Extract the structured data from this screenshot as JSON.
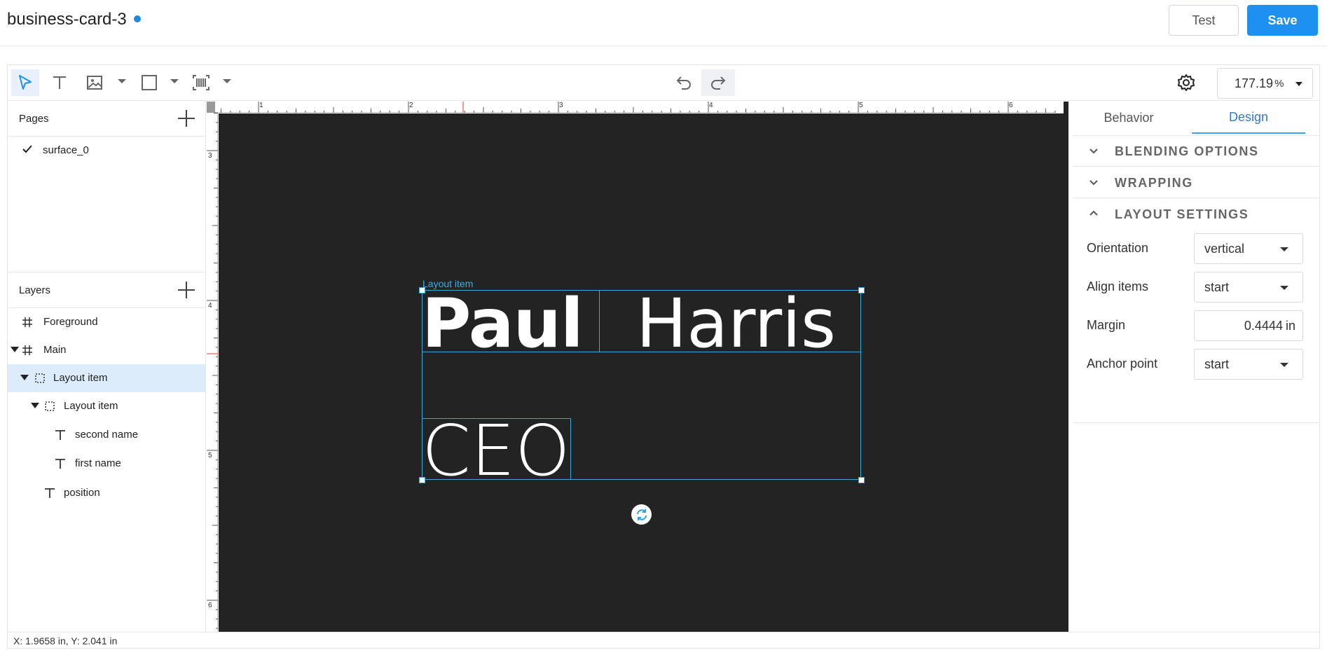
{
  "header": {
    "doc_title": "business-card-3",
    "test_label": "Test",
    "save_label": "Save"
  },
  "toolbar": {
    "tools": [
      "select-icon",
      "text-icon",
      "image-icon",
      "rectangle-icon",
      "barcode-icon"
    ],
    "undo_icon": "undo-icon",
    "redo_icon": "redo-icon",
    "settings_icon": "gear-icon",
    "zoom_value": "177.19",
    "zoom_unit": "%"
  },
  "pages": {
    "title": "Pages",
    "items": [
      {
        "name": "surface_0",
        "selected": true
      }
    ]
  },
  "layers": {
    "title": "Layers",
    "items": [
      {
        "label": "Foreground",
        "icon": "hash-icon"
      },
      {
        "label": "Main",
        "icon": "hash-icon",
        "expanded": true
      },
      {
        "label": "Layout item",
        "icon": "layout-item-icon",
        "expanded": true,
        "selected": true
      },
      {
        "label": "Layout item",
        "icon": "layout-item-icon",
        "expanded": true
      },
      {
        "label": "second name",
        "icon": "text-icon"
      },
      {
        "label": "first name",
        "icon": "text-icon"
      },
      {
        "label": "position",
        "icon": "text-icon"
      }
    ]
  },
  "canvas": {
    "selection_caption": "Layout item",
    "first_name": "Paul",
    "second_name": "Harris",
    "position": "CEO",
    "ruler_top": [
      "1",
      "2",
      "3",
      "4",
      "5",
      "6"
    ],
    "ruler_left": [
      "3",
      "4",
      "5",
      "6"
    ]
  },
  "right_panel": {
    "tabs": [
      "Behavior",
      "Design"
    ],
    "active_tab": "Design",
    "sections": [
      {
        "title": "BLENDING OPTIONS",
        "expanded": false
      },
      {
        "title": "WRAPPING",
        "expanded": false
      },
      {
        "title": "LAYOUT SETTINGS",
        "expanded": true
      }
    ],
    "layout": {
      "orientation_label": "Orientation",
      "orientation_value": "vertical",
      "align_label": "Align items",
      "align_value": "start",
      "margin_label": "Margin",
      "margin_value": "0.4444",
      "margin_unit": "in",
      "anchor_label": "Anchor point",
      "anchor_value": "start"
    }
  },
  "status": {
    "coords": "X: 1.9658 in, Y: 2.041 in"
  },
  "colors": {
    "accent": "#1e90f0",
    "canvas_bg": "#232323",
    "selection": "#3aa6d9",
    "layer_selected": "#dcecfb"
  }
}
